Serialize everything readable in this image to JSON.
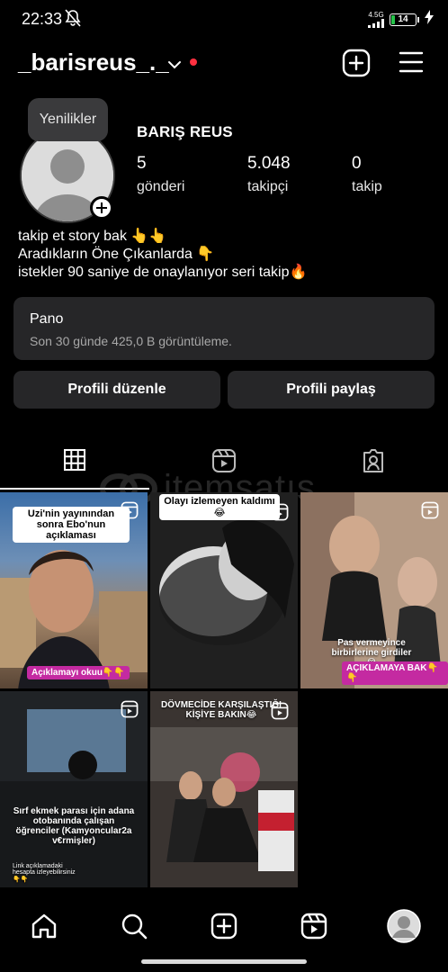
{
  "status": {
    "time": "22:33",
    "network": "4.5G",
    "battery": "14",
    "battery_level": 0.14
  },
  "header": {
    "username": "_barisreus_._",
    "icons": [
      "chevron-down-icon",
      "plus-square-icon",
      "menu-icon"
    ]
  },
  "profile": {
    "tooltip": "Yenilikler",
    "fullname": "BARIŞ REUS",
    "stats": [
      {
        "value": "5",
        "label": "gönderi"
      },
      {
        "value": "5.048",
        "label": "takipçi"
      },
      {
        "value": "0",
        "label": "takip"
      }
    ],
    "bio": [
      "takip et story bak 👆👆",
      "Aradıkların Öne Çıkanlarda 👇",
      "istekler 90 saniye de onaylanıyor seri takip🔥"
    ]
  },
  "dashboard": {
    "title": "Pano",
    "subtitle": "Son 30 günde 425,0 B görüntüleme."
  },
  "buttons": {
    "edit": "Profili düzenle",
    "share": "Profili paylaş"
  },
  "tabs": [
    "grid-icon",
    "reels-icon",
    "tagged-icon"
  ],
  "watermark": "itemsatış",
  "posts": [
    {
      "caption": "Uzi'nin yayınından sonra Ebo'nun açıklaması",
      "tag": "Açıklamayı okuu👇👇"
    },
    {
      "caption": "Olayı izlemeyen kaldımı😂"
    },
    {
      "caption": "Pas vermeyince birbirlerine girdiler😂",
      "tag": "AÇIKLAMAYA BAK👇👇"
    },
    {
      "caption": "Sırf ekmek parası için adana otobanında çalışan öğrenciler (Kamyoncular2a v€rmişler)",
      "tag": "Link açıklamadaki hesapta izleyebilirsiniz 👇👇"
    },
    {
      "caption": "DÖVMECİDE KARŞILAŞTIĞI KİŞİYE BAKIN😂"
    }
  ],
  "nav": [
    "home-icon",
    "search-icon",
    "create-icon",
    "reels-icon",
    "profile-avatar"
  ]
}
